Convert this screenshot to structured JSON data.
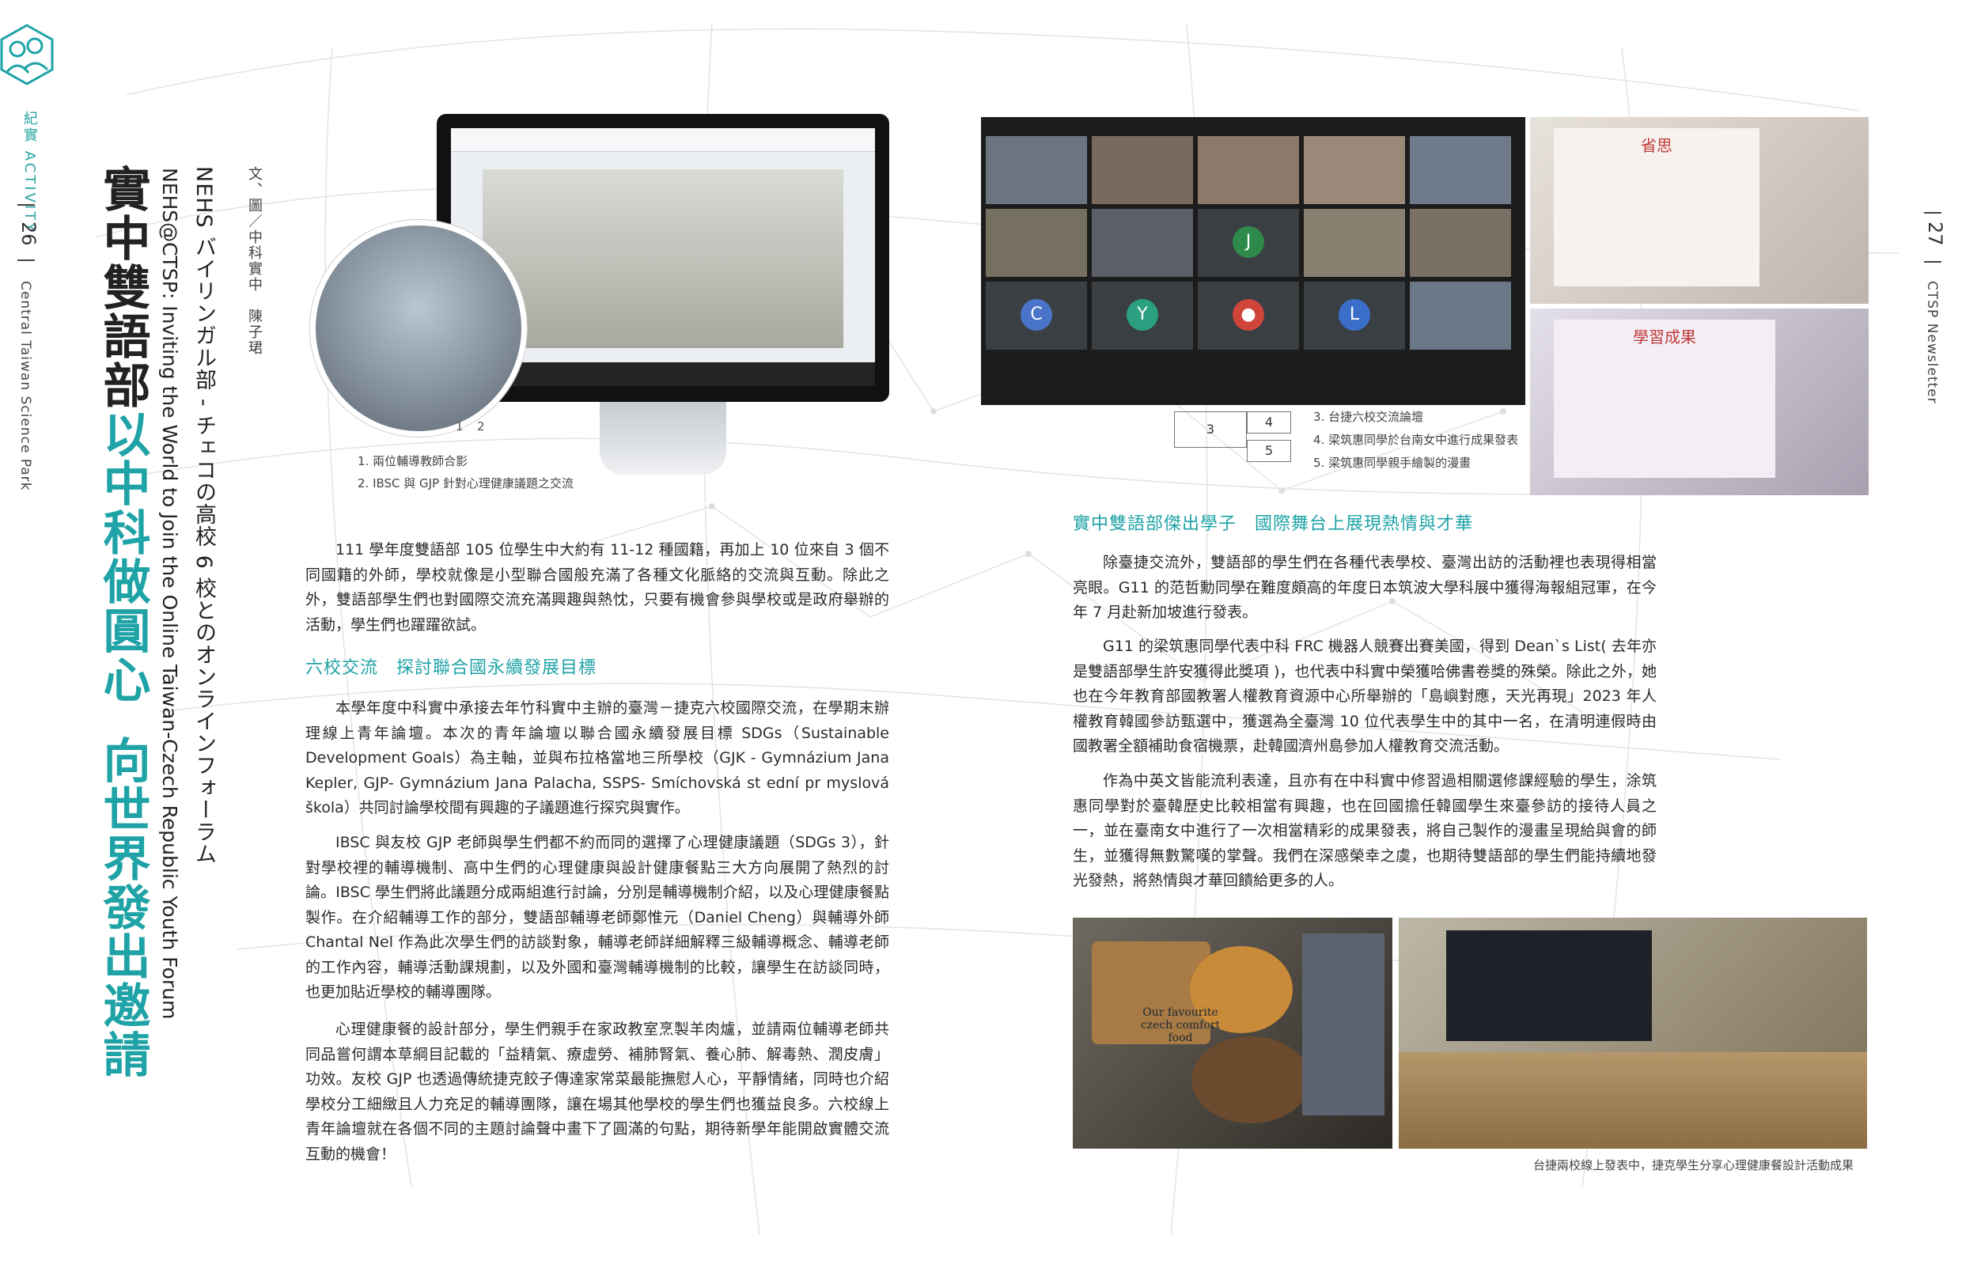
{
  "section": {
    "label": "紀實 ACTIVITY"
  },
  "pages": {
    "left_number": "26",
    "right_number": "27"
  },
  "publication": {
    "left": "Central Taiwan Science Park",
    "right": "CTSP Newsletter"
  },
  "article": {
    "title_part1": "實中雙語部",
    "title_part2": "以中科做圓心",
    "title_part3": "向世界發出邀請",
    "subtitle_jp": "NEHS バイリンガル部 - チェコの高校 6 校とのオンラインフォーラム",
    "subtitle_en": "NEHS@CTSP: Inviting the World to Join the Online Taiwan-Czech Republic Youth Forum",
    "author": "文、圖／中科實中　陳子珺"
  },
  "figures": {
    "num1": "1",
    "num2": "2",
    "num3": "3",
    "num4": "4",
    "num5": "5",
    "caption1": "1. 兩位輔導教師合影",
    "caption2": "2. IBSC 與 GJP 針對心理健康議題之交流",
    "caption3": "3. 台捷六校交流論壇",
    "caption4": "4. 梁筑惠同學於台南女中進行成果發表",
    "caption5": "5. 梁筑惠同學親手繪製的漫畫",
    "caption_bottom": "台捷兩校線上發表中，捷克學生分享心理健康餐設計活動成果",
    "food_text": "Our favourite czech comfort food",
    "zoom_letters": [
      "J",
      "C",
      "Y",
      "L"
    ],
    "slide1_title": "省思",
    "slide2_title": "學習成果"
  },
  "body": {
    "p1": "111 學年度雙語部 105 位學生中大約有 11-12 種國籍，再加上 10 位來自 3 個不同國籍的外師，學校就像是小型聯合國般充滿了各種文化脈絡的交流與互動。除此之外，雙語部學生們也對國際交流充滿興趣與熱忱，只要有機會參與學校或是政府舉辦的活動，學生們也躍躍欲試。",
    "h1": "六校交流　探討聯合國永續發展目標",
    "p2": "本學年度中科實中承接去年竹科實中主辦的臺灣－捷克六校國際交流，在學期末辦理線上青年論壇。本次的青年論壇以聯合國永續發展目標 SDGs（Sustainable Development Goals）為主軸，並與布拉格當地三所學校（GJK - Gymnázium Jana Kepler, GJP- Gymnázium Jana Palacha, SSPS- Smíchovská st ední pr myslová škola）共同討論學校間有興趣的子議題進行探究與實作。",
    "p3": "IBSC 與友校 GJP 老師與學生們都不約而同的選擇了心理健康議題（SDGs 3），針對學校裡的輔導機制、高中生們的心理健康與設計健康餐點三大方向展開了熱烈的討論。IBSC 學生們將此議題分成兩組進行討論，分別是輔導機制介紹，以及心理健康餐點製作。在介紹輔導工作的部分，雙語部輔導老師鄭惟元（Daniel Cheng）與輔導外師 Chantal Nel 作為此次學生們的訪談對象，輔導老師詳細解釋三級輔導概念、輔導老師的工作內容，輔導活動課規劃，以及外國和臺灣輔導機制的比較，讓學生在訪談同時，也更加貼近學校的輔導團隊。",
    "p4": "心理健康餐的設計部分，學生們親手在家政教室烹製羊肉爐，並請兩位輔導老師共同品嘗何謂本草綱目記載的「益精氣、療虛勞、補肺腎氣、養心肺、解毒熱、潤皮膚」功效。友校 GJP 也透過傳統捷克餃子傳達家常菜最能撫慰人心，平靜情緒，同時也介紹學校分工細緻且人力充足的輔導團隊，讓在場其他學校的學生們也獲益良多。六校線上青年論壇就在各個不同的主題討論聲中畫下了圓滿的句點，期待新學年能開啟實體交流互動的機會！",
    "h2": "實中雙語部傑出學子　國際舞台上展現熱情與才華",
    "p5": "除臺捷交流外，雙語部的學生們在各種代表學校、臺灣出訪的活動裡也表現得相當亮眼。G11 的范哲勳同學在難度頗高的年度日本筑波大學科展中獲得海報組冠軍，在今年 7 月赴新加坡進行發表。",
    "p6": "G11 的梁筑惠同學代表中科 FRC 機器人競賽出賽美國，得到 Dean`s List( 去年亦是雙語部學生許安獲得此獎項 )，也代表中科實中榮獲哈佛書卷獎的殊榮。除此之外，她也在今年教育部國教署人權教育資源中心所舉辦的「島嶼對應，天光再現」2023 年人權教育韓國參訪甄選中，獲選為全臺灣 10 位代表學生中的其中一名，在清明連假時由國教署全額補助食宿機票，赴韓國濟州島參加人權教育交流活動。",
    "p7": "作為中英文皆能流利表達，且亦有在中科實中修習過相關選修課經驗的學生，涂筑惠同學對於臺韓歷史比較相當有興趣，也在回國擔任韓國學生來臺參訪的接待人員之一，並在臺南女中進行了一次相當精彩的成果發表，將自己製作的漫畫呈現給與會的師生，並獲得無數驚嘆的掌聲。我們在深感榮幸之虞，也期待雙語部的學生們能持續地發光發熱，將熱情與才華回饋給更多的人。"
  },
  "colors": {
    "accent": "#1fa3a6",
    "text": "#2b2b2b"
  }
}
